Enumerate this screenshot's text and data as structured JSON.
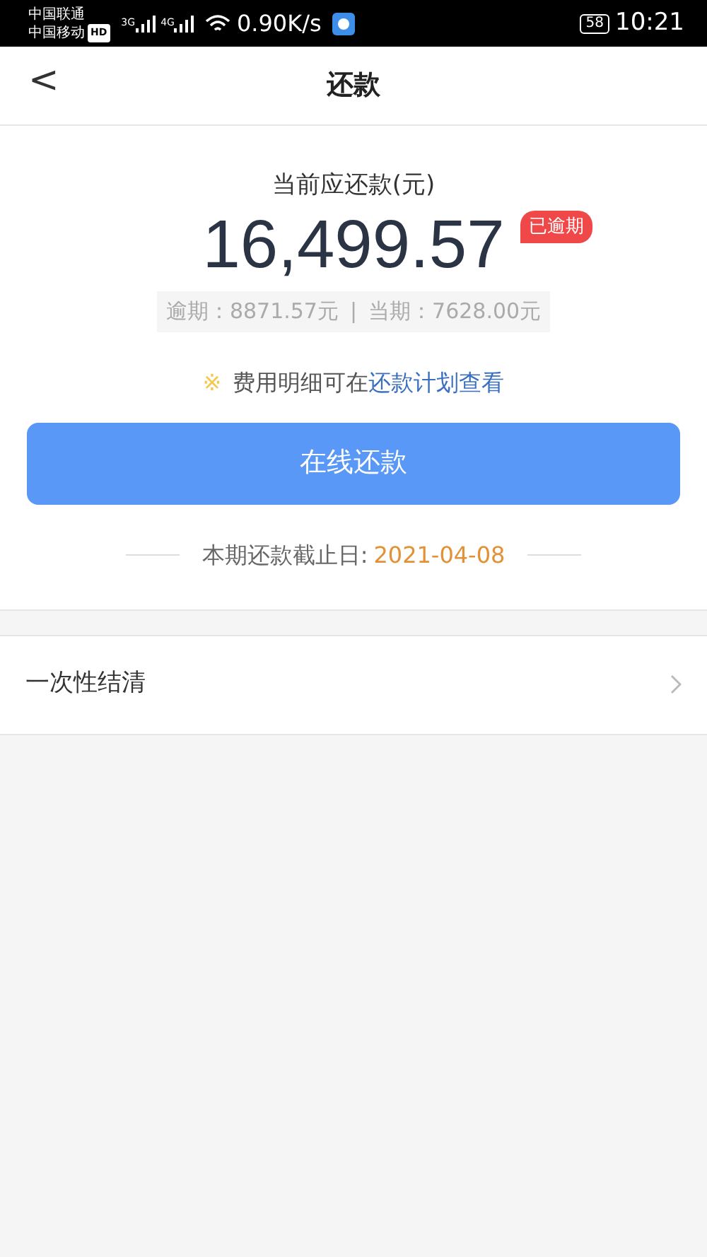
{
  "status_bar": {
    "carriers": [
      {
        "name": "中国联通"
      },
      {
        "name": "中国移动",
        "badge": "HD"
      }
    ],
    "signals": [
      {
        "label": "3G"
      },
      {
        "label": "4G"
      }
    ],
    "speed": "0.90K/s",
    "battery": "58",
    "time": "10:21"
  },
  "header": {
    "back": "<",
    "title": "还款"
  },
  "summary": {
    "label": "当前应还款(元)",
    "amount": "16,499.57",
    "badge": "已逾期",
    "breakdown": [
      {
        "label": "逾期：",
        "value": "8871.57元"
      },
      {
        "label": "当期：",
        "value": "7628.00元"
      }
    ],
    "separator": "|",
    "note_mark": "※",
    "note": "费用明细可在",
    "note_link": "还款计划查看",
    "button": "在线还款",
    "deadline_label": "本期还款截止日:",
    "deadline": "2021-04-08"
  },
  "list": [
    {
      "label": "一次性结清"
    }
  ]
}
